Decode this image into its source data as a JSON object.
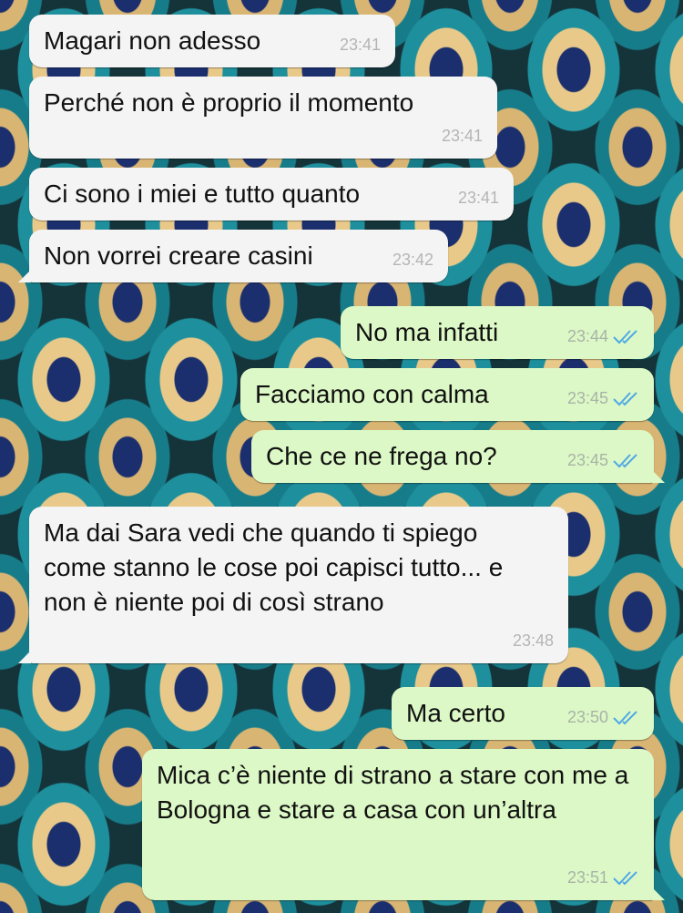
{
  "colors": {
    "incoming_bubble": "#f4f4f4",
    "outgoing_bubble": "#dcf8c6",
    "read_ticks": "#4fa9e6",
    "timestamp": "#a9b3a7"
  },
  "messages": [
    {
      "direction": "in",
      "text": "Magari non adesso",
      "time": "23:41"
    },
    {
      "direction": "in",
      "text": "Perché non è proprio il momento",
      "time": "23:41"
    },
    {
      "direction": "in",
      "text": "Ci sono i miei e tutto quanto",
      "time": "23:41"
    },
    {
      "direction": "in",
      "text": "Non vorrei creare casini",
      "time": "23:42"
    },
    {
      "direction": "out",
      "text": "No ma infatti",
      "time": "23:44",
      "status": "read-ticks-icon"
    },
    {
      "direction": "out",
      "text": "Facciamo con calma",
      "time": "23:45",
      "status": "read-ticks-icon"
    },
    {
      "direction": "out",
      "text": "Che ce ne frega no?",
      "time": "23:45",
      "status": "read-ticks-icon"
    },
    {
      "direction": "in",
      "text": "Ma dai Sara vedi che quando ti spiego come stanno le cose poi capisci tutto... e non è niente poi di così strano",
      "time": "23:48"
    },
    {
      "direction": "out",
      "text": "Ma certo",
      "time": "23:50",
      "status": "read-ticks-icon"
    },
    {
      "direction": "out",
      "text": "Mica c’è niente di strano a stare con me a Bologna e stare a casa con un’altra",
      "time": "23:51",
      "status": "read-ticks-icon"
    }
  ]
}
